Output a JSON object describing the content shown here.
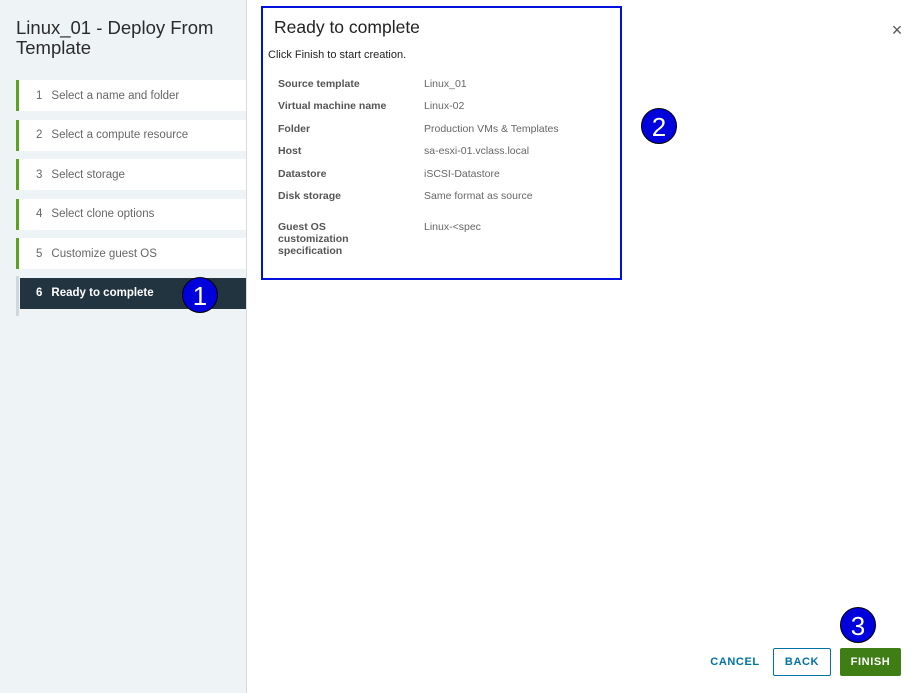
{
  "wizard": {
    "title": "Linux_01 - Deploy From Template",
    "steps": [
      {
        "num": "1",
        "label": "Select a name and folder"
      },
      {
        "num": "2",
        "label": "Select a compute resource"
      },
      {
        "num": "3",
        "label": "Select storage"
      },
      {
        "num": "4",
        "label": "Select clone options"
      },
      {
        "num": "5",
        "label": "Customize guest OS"
      },
      {
        "num": "6",
        "label": "Ready to complete"
      }
    ],
    "active_step": 6
  },
  "review": {
    "title": "Ready to complete",
    "subtitle": "Click Finish to start creation.",
    "rows": [
      {
        "key": "Source template",
        "value": "Linux_01"
      },
      {
        "key": "Virtual machine name",
        "value": "Linux-02"
      },
      {
        "key": "Folder",
        "value": "Production VMs & Templates"
      },
      {
        "key": "Host",
        "value": "sa-esxi-01.vclass.local"
      },
      {
        "key": "Datastore",
        "value": "iSCSI-Datastore"
      },
      {
        "key": "Disk storage",
        "value": "Same format as source"
      },
      {
        "key": "Guest OS customization specification",
        "value": "Linux-<spec"
      }
    ]
  },
  "callouts": {
    "one": "1",
    "two": "2",
    "three": "3"
  },
  "footer": {
    "cancel": "CANCEL",
    "back": "BACK",
    "finish": "FINISH"
  },
  "colors": {
    "accent": "#0072a3",
    "finish": "#3e7e15",
    "active_step": "#22343f",
    "callout": "#0000dd",
    "step_bar": "#5aa220"
  }
}
